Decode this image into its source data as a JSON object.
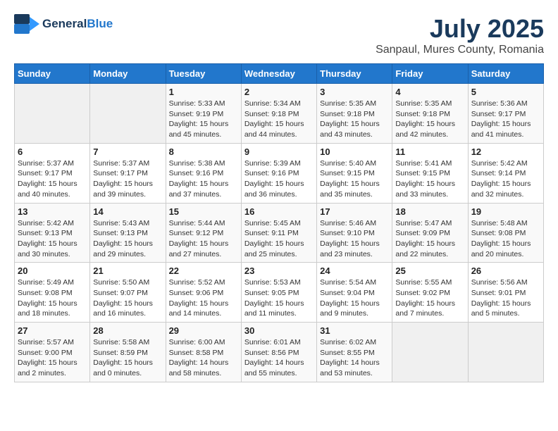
{
  "header": {
    "logo_general": "General",
    "logo_blue": "Blue",
    "title": "July 2025",
    "location": "Sanpaul, Mures County, Romania"
  },
  "calendar": {
    "days_of_week": [
      "Sunday",
      "Monday",
      "Tuesday",
      "Wednesday",
      "Thursday",
      "Friday",
      "Saturday"
    ],
    "weeks": [
      [
        {
          "day": "",
          "empty": true
        },
        {
          "day": "",
          "empty": true
        },
        {
          "day": "1",
          "sunrise": "Sunrise: 5:33 AM",
          "sunset": "Sunset: 9:19 PM",
          "daylight": "Daylight: 15 hours and 45 minutes."
        },
        {
          "day": "2",
          "sunrise": "Sunrise: 5:34 AM",
          "sunset": "Sunset: 9:18 PM",
          "daylight": "Daylight: 15 hours and 44 minutes."
        },
        {
          "day": "3",
          "sunrise": "Sunrise: 5:35 AM",
          "sunset": "Sunset: 9:18 PM",
          "daylight": "Daylight: 15 hours and 43 minutes."
        },
        {
          "day": "4",
          "sunrise": "Sunrise: 5:35 AM",
          "sunset": "Sunset: 9:18 PM",
          "daylight": "Daylight: 15 hours and 42 minutes."
        },
        {
          "day": "5",
          "sunrise": "Sunrise: 5:36 AM",
          "sunset": "Sunset: 9:17 PM",
          "daylight": "Daylight: 15 hours and 41 minutes."
        }
      ],
      [
        {
          "day": "6",
          "sunrise": "Sunrise: 5:37 AM",
          "sunset": "Sunset: 9:17 PM",
          "daylight": "Daylight: 15 hours and 40 minutes."
        },
        {
          "day": "7",
          "sunrise": "Sunrise: 5:37 AM",
          "sunset": "Sunset: 9:17 PM",
          "daylight": "Daylight: 15 hours and 39 minutes."
        },
        {
          "day": "8",
          "sunrise": "Sunrise: 5:38 AM",
          "sunset": "Sunset: 9:16 PM",
          "daylight": "Daylight: 15 hours and 37 minutes."
        },
        {
          "day": "9",
          "sunrise": "Sunrise: 5:39 AM",
          "sunset": "Sunset: 9:16 PM",
          "daylight": "Daylight: 15 hours and 36 minutes."
        },
        {
          "day": "10",
          "sunrise": "Sunrise: 5:40 AM",
          "sunset": "Sunset: 9:15 PM",
          "daylight": "Daylight: 15 hours and 35 minutes."
        },
        {
          "day": "11",
          "sunrise": "Sunrise: 5:41 AM",
          "sunset": "Sunset: 9:15 PM",
          "daylight": "Daylight: 15 hours and 33 minutes."
        },
        {
          "day": "12",
          "sunrise": "Sunrise: 5:42 AM",
          "sunset": "Sunset: 9:14 PM",
          "daylight": "Daylight: 15 hours and 32 minutes."
        }
      ],
      [
        {
          "day": "13",
          "sunrise": "Sunrise: 5:42 AM",
          "sunset": "Sunset: 9:13 PM",
          "daylight": "Daylight: 15 hours and 30 minutes."
        },
        {
          "day": "14",
          "sunrise": "Sunrise: 5:43 AM",
          "sunset": "Sunset: 9:13 PM",
          "daylight": "Daylight: 15 hours and 29 minutes."
        },
        {
          "day": "15",
          "sunrise": "Sunrise: 5:44 AM",
          "sunset": "Sunset: 9:12 PM",
          "daylight": "Daylight: 15 hours and 27 minutes."
        },
        {
          "day": "16",
          "sunrise": "Sunrise: 5:45 AM",
          "sunset": "Sunset: 9:11 PM",
          "daylight": "Daylight: 15 hours and 25 minutes."
        },
        {
          "day": "17",
          "sunrise": "Sunrise: 5:46 AM",
          "sunset": "Sunset: 9:10 PM",
          "daylight": "Daylight: 15 hours and 23 minutes."
        },
        {
          "day": "18",
          "sunrise": "Sunrise: 5:47 AM",
          "sunset": "Sunset: 9:09 PM",
          "daylight": "Daylight: 15 hours and 22 minutes."
        },
        {
          "day": "19",
          "sunrise": "Sunrise: 5:48 AM",
          "sunset": "Sunset: 9:08 PM",
          "daylight": "Daylight: 15 hours and 20 minutes."
        }
      ],
      [
        {
          "day": "20",
          "sunrise": "Sunrise: 5:49 AM",
          "sunset": "Sunset: 9:08 PM",
          "daylight": "Daylight: 15 hours and 18 minutes."
        },
        {
          "day": "21",
          "sunrise": "Sunrise: 5:50 AM",
          "sunset": "Sunset: 9:07 PM",
          "daylight": "Daylight: 15 hours and 16 minutes."
        },
        {
          "day": "22",
          "sunrise": "Sunrise: 5:52 AM",
          "sunset": "Sunset: 9:06 PM",
          "daylight": "Daylight: 15 hours and 14 minutes."
        },
        {
          "day": "23",
          "sunrise": "Sunrise: 5:53 AM",
          "sunset": "Sunset: 9:05 PM",
          "daylight": "Daylight: 15 hours and 11 minutes."
        },
        {
          "day": "24",
          "sunrise": "Sunrise: 5:54 AM",
          "sunset": "Sunset: 9:04 PM",
          "daylight": "Daylight: 15 hours and 9 minutes."
        },
        {
          "day": "25",
          "sunrise": "Sunrise: 5:55 AM",
          "sunset": "Sunset: 9:02 PM",
          "daylight": "Daylight: 15 hours and 7 minutes."
        },
        {
          "day": "26",
          "sunrise": "Sunrise: 5:56 AM",
          "sunset": "Sunset: 9:01 PM",
          "daylight": "Daylight: 15 hours and 5 minutes."
        }
      ],
      [
        {
          "day": "27",
          "sunrise": "Sunrise: 5:57 AM",
          "sunset": "Sunset: 9:00 PM",
          "daylight": "Daylight: 15 hours and 2 minutes."
        },
        {
          "day": "28",
          "sunrise": "Sunrise: 5:58 AM",
          "sunset": "Sunset: 8:59 PM",
          "daylight": "Daylight: 15 hours and 0 minutes."
        },
        {
          "day": "29",
          "sunrise": "Sunrise: 6:00 AM",
          "sunset": "Sunset: 8:58 PM",
          "daylight": "Daylight: 14 hours and 58 minutes."
        },
        {
          "day": "30",
          "sunrise": "Sunrise: 6:01 AM",
          "sunset": "Sunset: 8:56 PM",
          "daylight": "Daylight: 14 hours and 55 minutes."
        },
        {
          "day": "31",
          "sunrise": "Sunrise: 6:02 AM",
          "sunset": "Sunset: 8:55 PM",
          "daylight": "Daylight: 14 hours and 53 minutes."
        },
        {
          "day": "",
          "empty": true
        },
        {
          "day": "",
          "empty": true
        }
      ]
    ]
  }
}
